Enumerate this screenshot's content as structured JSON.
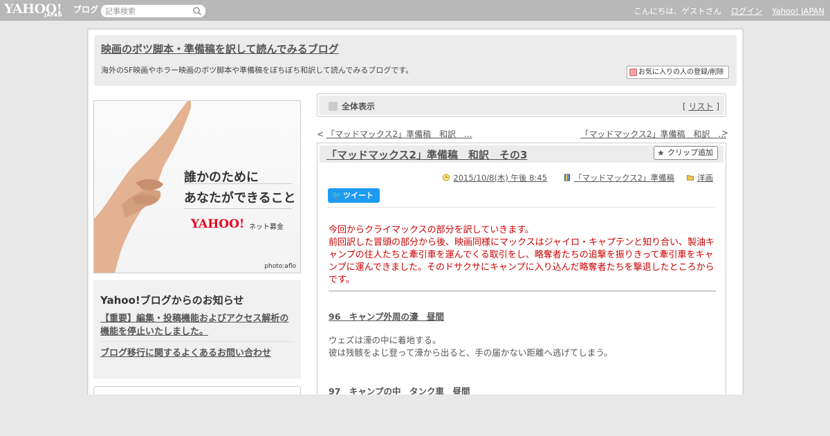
{
  "topbar": {
    "logo_text": "YAHOO!",
    "logo_sub": "JAPAN",
    "logo_blog": "ブログ",
    "search_placeholder": "記事検索",
    "greeting": "こんにちは、ゲストさん",
    "login": "ログイン",
    "yahoo_japan": "Yahoo! JAPAN"
  },
  "header": {
    "title": "映画のボツ脚本・準備稿を訳して読んでみるブログ",
    "description": "海外のSF映画やホラー映画のボツ脚本や準備稿をぼちぼち和訳して読んでみるブログです。",
    "favorite_button": "お気に入りの人の登録/削除"
  },
  "banner": {
    "line1": "誰かのために",
    "line2": "あなたができること",
    "logo": "YAHOO!",
    "sub": "ネット募金",
    "credit": "photo:aflo"
  },
  "notice": {
    "title": "Yahoo!ブログからのお知らせ",
    "item1": "【重要】編集・投稿機能およびアクセス解析の機能を停止いたしました。",
    "item2": "ブログ移行に関するよくあるお問い合わせ"
  },
  "allview": {
    "label": "全体表示",
    "list_open": "[",
    "list": "リスト",
    "list_close": "]"
  },
  "nav": {
    "prev_arrow": "<",
    "prev": "「マッドマックス2」準備稿　和訳　...",
    "next": "「マッドマックス2」準備稿　和訳　...",
    "next_arrow": ">"
  },
  "article": {
    "title": "「マッドマックス2」準備稿　和訳　その3",
    "clip_button": "クリップ追加",
    "date": "2015/10/8(木) 午後 8:45",
    "category": "「マッドマックス2」準備稿",
    "folder": "洋画",
    "tweet": "ツイート",
    "intro": "今回からクライマックスの部分を訳していきます。\n前回訳した冒頭の部分から後、映画同様にマックスはジャイロ・キャプテンと知り合い、製油キャンプの住人たちと牽引車を運んでくる取引をし、略奪者たちの追撃を振りきって牽引車をキャンプに運んできました。そのドサクサにキャンプに入り込んだ略奪者たちを撃退したところからです。",
    "section1": "96　キャンプ外周の濠　昼間",
    "body1": "ウェズは濠の中に着地する。\n彼は残骸をよじ登って濠から出ると、手の届かない距離へ逃げてしまう。",
    "section2": "97　キャンプの中　タンク車　昼間"
  }
}
